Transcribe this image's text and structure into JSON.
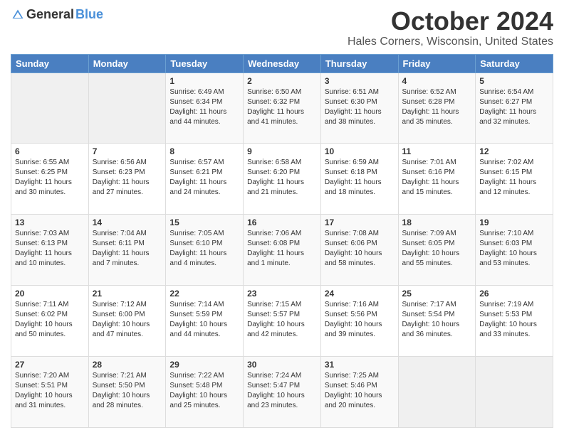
{
  "header": {
    "logo_general": "General",
    "logo_blue": "Blue",
    "month_title": "October 2024",
    "location": "Hales Corners, Wisconsin, United States"
  },
  "days_of_week": [
    "Sunday",
    "Monday",
    "Tuesday",
    "Wednesday",
    "Thursday",
    "Friday",
    "Saturday"
  ],
  "weeks": [
    [
      {
        "day": "",
        "info": ""
      },
      {
        "day": "",
        "info": ""
      },
      {
        "day": "1",
        "info": "Sunrise: 6:49 AM\nSunset: 6:34 PM\nDaylight: 11 hours and 44 minutes."
      },
      {
        "day": "2",
        "info": "Sunrise: 6:50 AM\nSunset: 6:32 PM\nDaylight: 11 hours and 41 minutes."
      },
      {
        "day": "3",
        "info": "Sunrise: 6:51 AM\nSunset: 6:30 PM\nDaylight: 11 hours and 38 minutes."
      },
      {
        "day": "4",
        "info": "Sunrise: 6:52 AM\nSunset: 6:28 PM\nDaylight: 11 hours and 35 minutes."
      },
      {
        "day": "5",
        "info": "Sunrise: 6:54 AM\nSunset: 6:27 PM\nDaylight: 11 hours and 32 minutes."
      }
    ],
    [
      {
        "day": "6",
        "info": "Sunrise: 6:55 AM\nSunset: 6:25 PM\nDaylight: 11 hours and 30 minutes."
      },
      {
        "day": "7",
        "info": "Sunrise: 6:56 AM\nSunset: 6:23 PM\nDaylight: 11 hours and 27 minutes."
      },
      {
        "day": "8",
        "info": "Sunrise: 6:57 AM\nSunset: 6:21 PM\nDaylight: 11 hours and 24 minutes."
      },
      {
        "day": "9",
        "info": "Sunrise: 6:58 AM\nSunset: 6:20 PM\nDaylight: 11 hours and 21 minutes."
      },
      {
        "day": "10",
        "info": "Sunrise: 6:59 AM\nSunset: 6:18 PM\nDaylight: 11 hours and 18 minutes."
      },
      {
        "day": "11",
        "info": "Sunrise: 7:01 AM\nSunset: 6:16 PM\nDaylight: 11 hours and 15 minutes."
      },
      {
        "day": "12",
        "info": "Sunrise: 7:02 AM\nSunset: 6:15 PM\nDaylight: 11 hours and 12 minutes."
      }
    ],
    [
      {
        "day": "13",
        "info": "Sunrise: 7:03 AM\nSunset: 6:13 PM\nDaylight: 11 hours and 10 minutes."
      },
      {
        "day": "14",
        "info": "Sunrise: 7:04 AM\nSunset: 6:11 PM\nDaylight: 11 hours and 7 minutes."
      },
      {
        "day": "15",
        "info": "Sunrise: 7:05 AM\nSunset: 6:10 PM\nDaylight: 11 hours and 4 minutes."
      },
      {
        "day": "16",
        "info": "Sunrise: 7:06 AM\nSunset: 6:08 PM\nDaylight: 11 hours and 1 minute."
      },
      {
        "day": "17",
        "info": "Sunrise: 7:08 AM\nSunset: 6:06 PM\nDaylight: 10 hours and 58 minutes."
      },
      {
        "day": "18",
        "info": "Sunrise: 7:09 AM\nSunset: 6:05 PM\nDaylight: 10 hours and 55 minutes."
      },
      {
        "day": "19",
        "info": "Sunrise: 7:10 AM\nSunset: 6:03 PM\nDaylight: 10 hours and 53 minutes."
      }
    ],
    [
      {
        "day": "20",
        "info": "Sunrise: 7:11 AM\nSunset: 6:02 PM\nDaylight: 10 hours and 50 minutes."
      },
      {
        "day": "21",
        "info": "Sunrise: 7:12 AM\nSunset: 6:00 PM\nDaylight: 10 hours and 47 minutes."
      },
      {
        "day": "22",
        "info": "Sunrise: 7:14 AM\nSunset: 5:59 PM\nDaylight: 10 hours and 44 minutes."
      },
      {
        "day": "23",
        "info": "Sunrise: 7:15 AM\nSunset: 5:57 PM\nDaylight: 10 hours and 42 minutes."
      },
      {
        "day": "24",
        "info": "Sunrise: 7:16 AM\nSunset: 5:56 PM\nDaylight: 10 hours and 39 minutes."
      },
      {
        "day": "25",
        "info": "Sunrise: 7:17 AM\nSunset: 5:54 PM\nDaylight: 10 hours and 36 minutes."
      },
      {
        "day": "26",
        "info": "Sunrise: 7:19 AM\nSunset: 5:53 PM\nDaylight: 10 hours and 33 minutes."
      }
    ],
    [
      {
        "day": "27",
        "info": "Sunrise: 7:20 AM\nSunset: 5:51 PM\nDaylight: 10 hours and 31 minutes."
      },
      {
        "day": "28",
        "info": "Sunrise: 7:21 AM\nSunset: 5:50 PM\nDaylight: 10 hours and 28 minutes."
      },
      {
        "day": "29",
        "info": "Sunrise: 7:22 AM\nSunset: 5:48 PM\nDaylight: 10 hours and 25 minutes."
      },
      {
        "day": "30",
        "info": "Sunrise: 7:24 AM\nSunset: 5:47 PM\nDaylight: 10 hours and 23 minutes."
      },
      {
        "day": "31",
        "info": "Sunrise: 7:25 AM\nSunset: 5:46 PM\nDaylight: 10 hours and 20 minutes."
      },
      {
        "day": "",
        "info": ""
      },
      {
        "day": "",
        "info": ""
      }
    ]
  ]
}
